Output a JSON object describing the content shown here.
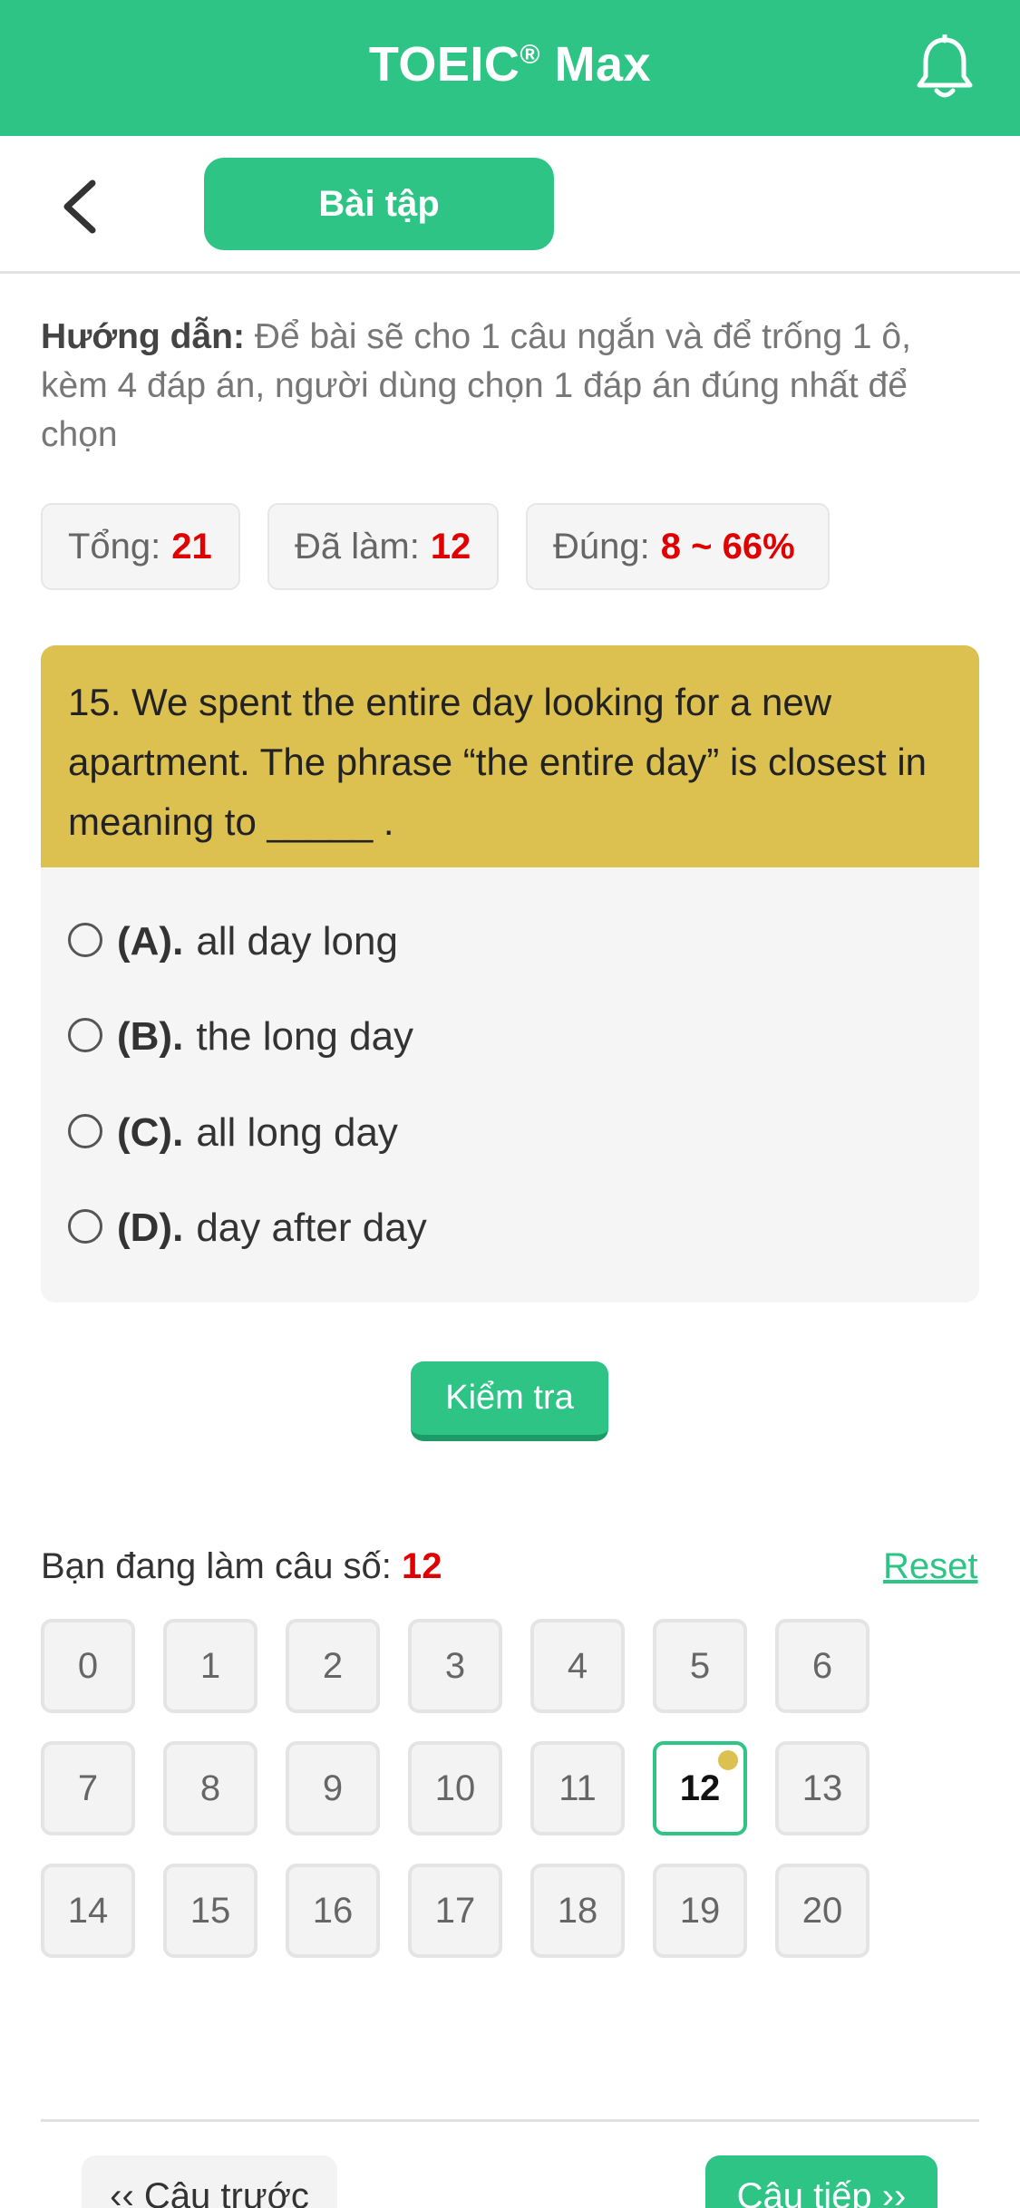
{
  "header": {
    "title": "TOEIC",
    "title_reg": "®",
    "title_suffix": " Max",
    "bell_icon": "bell-icon",
    "color": "#2ec486"
  },
  "subbar": {
    "back_icon": "chevron-left-icon",
    "tab_label": "Bài tập"
  },
  "instruction": {
    "label": "Hướng dẫn:",
    "text": " Để bài sẽ cho 1 câu ngắn và để trống 1 ô, kèm 4 đáp án, người dùng chọn 1 đáp án đúng nhất để chọn"
  },
  "stats": {
    "total_label": "Tổng:",
    "total_value": "21",
    "done_label": "Đã làm:",
    "done_value": "12",
    "correct_label": "Đúng:",
    "correct_value": "8 ~ 66%"
  },
  "question": {
    "text": "15. We spent the entire day looking for a new apartment. The phrase “the entire day” is closest in meaning to _____ .",
    "options": [
      {
        "letter": "(A).",
        "text": "all day long"
      },
      {
        "letter": "(B).",
        "text": "the long day"
      },
      {
        "letter": "(C).",
        "text": "all long day"
      },
      {
        "letter": "(D).",
        "text": "day after day"
      }
    ]
  },
  "check_button": "Kiểm tra",
  "progress": {
    "label": "Bạn đang làm câu số: ",
    "current": "12",
    "reset": "Reset"
  },
  "grid": {
    "numbers": [
      "0",
      "1",
      "2",
      "3",
      "4",
      "5",
      "6",
      "7",
      "8",
      "9",
      "10",
      "11",
      "12",
      "13",
      "14",
      "15",
      "16",
      "17",
      "18",
      "19",
      "20"
    ],
    "current_index": 12
  },
  "nav": {
    "prev": "‹‹ Câu trước",
    "next": "Câu tiếp ››"
  }
}
